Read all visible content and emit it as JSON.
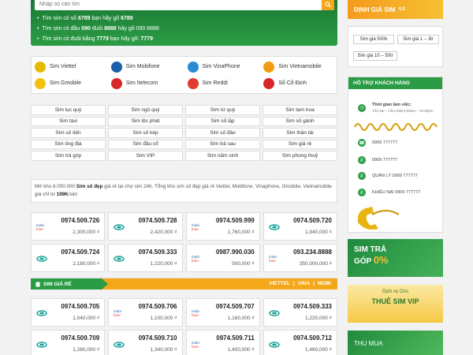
{
  "search": {
    "placeholder": "Nhập số cần tìm"
  },
  "hints": [
    {
      "pre": "Tìm sim có số ",
      "b1": "6789",
      "mid": " bạn hãy gõ ",
      "b2": "6789",
      "post": ""
    },
    {
      "pre": "Tìm sim có đầu ",
      "b1": "090",
      "mid": " đuôi ",
      "b2": "8888",
      "post": " hãy gõ 090 8888"
    },
    {
      "pre": "Tìm sim có đuôi bằng ",
      "b1": "7779",
      "mid": " bạn hãy gõ: ",
      "b2": "7779",
      "post": ""
    }
  ],
  "networks": [
    {
      "label": "Sim Viettel",
      "color": "#e6b800"
    },
    {
      "label": "Sim Mobifone",
      "color": "#1b5fa8"
    },
    {
      "label": "Sim VinaPhone",
      "color": "#2a8ad4"
    },
    {
      "label": "Sim Vietnamobile",
      "color": "#f39c12"
    },
    {
      "label": "Sim Gmobile",
      "color": "#f4c10f"
    },
    {
      "label": "Sim Itelecom",
      "color": "#d8262a"
    },
    {
      "label": "Sim Reddi",
      "color": "#e33b2f"
    },
    {
      "label": "Số Cố Định",
      "color": "#d8262a"
    }
  ],
  "categories": [
    "Sim lục quý",
    "Sim ngũ quý",
    "Sim tứ quý",
    "Sim tam hoa",
    "Sim taxi",
    "Sim lộc phát",
    "Sim số lặp",
    "Sim số gánh",
    "Sim số tiến",
    "Sim số kép",
    "Sim số đảo",
    "Sim thần tài",
    "Sim ông địa",
    "Sim đầu cổ",
    "Sim trả sau",
    "Sim giá rẻ",
    "Sim trả góp",
    "Sim VIP",
    "Sim năm sinh",
    "Sim phong thuỷ"
  ],
  "desc": {
    "p1": "Mở kho 8.000.000 ",
    "b1": "Sim số đẹp",
    "p2": " giá rẻ tại chợ sim 24h. Tổng kho sim số đẹp giá rẻ Viettel, Mobifone, Vinaphone, Gmobile, Vietnamobile giá chỉ từ ",
    "b2": "199K",
    "p3": "/sim"
  },
  "sims_top": [
    {
      "num": "0974.509.726",
      "price": "2,300,000 ₫",
      "carrier": "mobifone"
    },
    {
      "num": "0974.509.728",
      "price": "2,420,000 ₫",
      "carrier": "viettel"
    },
    {
      "num": "0974.509.999",
      "price": "1,760,000 ₫",
      "carrier": "mobifone"
    },
    {
      "num": "0974.509.720",
      "price": "1,940,000 ₫",
      "carrier": "viettel"
    },
    {
      "num": "0974.509.724",
      "price": "2,180,000 ₫",
      "carrier": "viettel"
    },
    {
      "num": "0974.509.333",
      "price": "1,220,000 ₫",
      "carrier": "viettel"
    },
    {
      "num": "0987.990.030",
      "price": "500,000 ₫",
      "carrier": "mobifone"
    },
    {
      "num": "093.234.8888",
      "price": "350,000,000 ₫",
      "carrier": "mobifone"
    }
  ],
  "section": {
    "title": "SIM GIÁ RẺ",
    "tabs": [
      "VIETTEL",
      "VINA",
      "MOBI"
    ]
  },
  "sims_cheap": [
    {
      "num": "0974.509.705",
      "price": "1,040,000 ₫",
      "carrier": "viettel"
    },
    {
      "num": "0974.509.706",
      "price": "1,100,000 ₫",
      "carrier": "mobifone"
    },
    {
      "num": "0974.509.707",
      "price": "1,160,000 ₫",
      "carrier": "mobifone"
    },
    {
      "num": "0974.509.333",
      "price": "1,220,000 ₫",
      "carrier": "viettel"
    },
    {
      "num": "0974.509.709",
      "price": "1,280,000 ₫",
      "carrier": "viettel"
    },
    {
      "num": "0974.509.710",
      "price": "1,340,000 ₫",
      "carrier": "viettel"
    },
    {
      "num": "0974.509.711",
      "price": "1,400,000 ₫",
      "carrier": "mobifone"
    },
    {
      "num": "0974.509.712",
      "price": "1,460,000 ₫",
      "carrier": "viettel"
    }
  ],
  "sidebar": {
    "banner_title": "ĐỊNH GIÁ SIM",
    "banner_sub": "4.0",
    "price_filters": [
      "Sim giá 500k",
      "Sim giá 1 – 3tr",
      "Sim giá 10 – 50tr"
    ],
    "support_title": "HỖ TRỢ KHÁCH HÀNG",
    "hours_label": "Thời gian làm việc:",
    "hours_value": "Thứ hai – Chủ nhật 8:00am – 10:00pm",
    "phone1": "0909 777777",
    "phone2": "0909 777777",
    "manager": "QUẢN LÝ 0909 777777",
    "complaint": "KHIẾU NẠI 0909 777777",
    "promo1_a": "SIM TRẢ",
    "promo1_b": "GÓP",
    "promo1_c": "0%",
    "promo2_small": "Dịch vụ Cho",
    "promo2_big": "THUÊ SIM VIP",
    "promo3": "THU MUA"
  },
  "colors": {
    "green": "#2b9c45",
    "orange": "#f3a719",
    "viettel": "#1aa39a",
    "mobifone": "#1b5fa8"
  }
}
